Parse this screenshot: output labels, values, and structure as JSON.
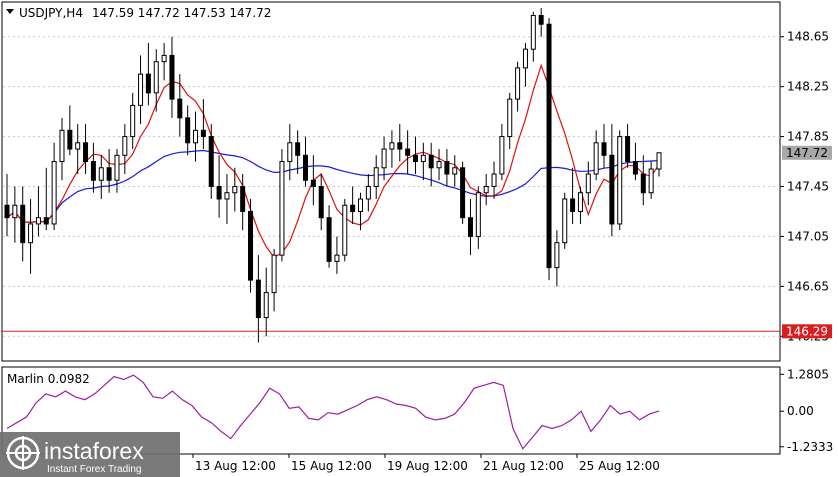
{
  "colors": {
    "bull_fill": "#ffffff",
    "bear_fill": "#000000",
    "candle_stroke": "#000000",
    "ma_fast": "#dd1111",
    "ma_slow": "#1a1adc",
    "support": "#d62020",
    "support_label_bg": "#d62020",
    "price_label_bg": "#a8a8a8",
    "marlin": "#9b1fa0",
    "grid": "#c8c8c8"
  },
  "header": {
    "symbol": "USDJPY,H4",
    "ohlc": "147.59 147.72 147.53 147.72"
  },
  "chart_data": [
    {
      "type": "candlestick",
      "title": "USDJPY,H4",
      "ylim": [
        146.06,
        148.92
      ],
      "y_ticks": [
        "148.65",
        "148.25",
        "147.85",
        "147.45",
        "147.05",
        "146.65",
        "146.25"
      ],
      "x_labels": [
        "13 Aug 12:00",
        "15 Aug 12:00",
        "19 Aug 12:00",
        "21 Aug 12:00",
        "25 Aug 12:00"
      ],
      "grid": true,
      "last_price": "147.72",
      "support_level": "146.29",
      "candles": [
        [
          147.3,
          147.55,
          147.05,
          147.2
        ],
        [
          147.2,
          147.45,
          147.0,
          147.3
        ],
        [
          147.3,
          147.45,
          146.85,
          147.0
        ],
        [
          147.0,
          147.35,
          146.75,
          147.15
        ],
        [
          147.15,
          147.45,
          147.05,
          147.2
        ],
        [
          147.2,
          147.6,
          147.1,
          147.15
        ],
        [
          147.15,
          147.8,
          147.1,
          147.65
        ],
        [
          147.65,
          148.0,
          147.5,
          147.9
        ],
        [
          147.9,
          148.1,
          147.7,
          147.75
        ],
        [
          147.75,
          147.95,
          147.55,
          147.8
        ],
        [
          147.8,
          147.95,
          147.55,
          147.65
        ],
        [
          147.65,
          147.8,
          147.4,
          147.5
        ],
        [
          147.5,
          147.7,
          147.35,
          147.6
        ],
        [
          147.6,
          147.75,
          147.4,
          147.5
        ],
        [
          147.5,
          147.75,
          147.4,
          147.7
        ],
        [
          147.7,
          147.95,
          147.55,
          147.85
        ],
        [
          147.85,
          148.2,
          147.75,
          148.1
        ],
        [
          148.1,
          148.5,
          147.95,
          148.35
        ],
        [
          148.35,
          148.6,
          148.1,
          148.2
        ],
        [
          148.2,
          148.55,
          148.05,
          148.45
        ],
        [
          148.45,
          148.6,
          148.3,
          148.5
        ],
        [
          148.5,
          148.65,
          148.0,
          148.15
        ],
        [
          148.15,
          148.35,
          147.85,
          148.0
        ],
        [
          148.0,
          148.1,
          147.7,
          147.8
        ],
        [
          147.8,
          148.05,
          147.65,
          147.9
        ],
        [
          147.9,
          148.15,
          147.75,
          147.85
        ],
        [
          147.85,
          147.95,
          147.35,
          147.45
        ],
        [
          147.45,
          147.7,
          147.2,
          147.35
        ],
        [
          147.35,
          147.55,
          147.15,
          147.4
        ],
        [
          147.4,
          147.6,
          147.25,
          147.45
        ],
        [
          147.45,
          147.55,
          147.1,
          147.25
        ],
        [
          147.25,
          147.35,
          146.6,
          146.7
        ],
        [
          146.7,
          146.9,
          146.2,
          146.4
        ],
        [
          146.4,
          146.8,
          146.25,
          146.6
        ],
        [
          146.6,
          146.95,
          146.45,
          146.9
        ],
        [
          146.9,
          147.75,
          146.85,
          147.65
        ],
        [
          147.65,
          147.95,
          147.5,
          147.8
        ],
        [
          147.8,
          147.9,
          147.55,
          147.7
        ],
        [
          147.7,
          147.85,
          147.45,
          147.5
        ],
        [
          147.5,
          147.7,
          147.3,
          147.45
        ],
        [
          147.45,
          147.55,
          147.1,
          147.2
        ],
        [
          147.2,
          147.3,
          146.8,
          146.85
        ],
        [
          146.85,
          147.05,
          146.75,
          146.9
        ],
        [
          146.9,
          147.35,
          146.85,
          147.3
        ],
        [
          147.3,
          147.45,
          147.15,
          147.25
        ],
        [
          147.25,
          147.4,
          147.1,
          147.35
        ],
        [
          147.35,
          147.55,
          147.25,
          147.45
        ],
        [
          147.45,
          147.7,
          147.35,
          147.6
        ],
        [
          147.6,
          147.85,
          147.5,
          147.75
        ],
        [
          147.75,
          147.9,
          147.6,
          147.8
        ],
        [
          147.8,
          147.95,
          147.65,
          147.75
        ],
        [
          147.75,
          147.9,
          147.55,
          147.7
        ],
        [
          147.7,
          147.85,
          147.55,
          147.65
        ],
        [
          147.65,
          147.8,
          147.5,
          147.7
        ],
        [
          147.7,
          147.8,
          147.45,
          147.6
        ],
        [
          147.6,
          147.75,
          147.5,
          147.65
        ],
        [
          147.65,
          147.75,
          147.45,
          147.55
        ],
        [
          147.55,
          147.7,
          147.45,
          147.6
        ],
        [
          147.6,
          147.65,
          147.15,
          147.2
        ],
        [
          147.2,
          147.35,
          146.9,
          147.05
        ],
        [
          147.05,
          147.45,
          146.95,
          147.4
        ],
        [
          147.4,
          147.55,
          147.3,
          147.45
        ],
        [
          147.45,
          147.65,
          147.35,
          147.55
        ],
        [
          147.55,
          147.95,
          147.5,
          147.85
        ],
        [
          147.85,
          148.2,
          147.75,
          148.15
        ],
        [
          148.15,
          148.45,
          148.05,
          148.4
        ],
        [
          148.4,
          148.6,
          148.25,
          148.55
        ],
        [
          148.55,
          148.85,
          148.45,
          148.82
        ],
        [
          148.82,
          148.88,
          148.65,
          148.75
        ],
        [
          148.75,
          148.8,
          146.7,
          146.8
        ],
        [
          146.8,
          147.1,
          146.65,
          147.0
        ],
        [
          147.0,
          147.4,
          146.95,
          147.35
        ],
        [
          147.35,
          147.6,
          147.15,
          147.25
        ],
        [
          147.25,
          147.45,
          147.15,
          147.4
        ],
        [
          147.4,
          147.65,
          147.3,
          147.55
        ],
        [
          147.55,
          147.9,
          147.5,
          147.8
        ],
        [
          147.8,
          147.95,
          147.6,
          147.7
        ],
        [
          147.7,
          147.95,
          147.05,
          147.15
        ],
        [
          147.15,
          147.9,
          147.1,
          147.85
        ],
        [
          147.85,
          147.95,
          147.6,
          147.65
        ],
        [
          147.65,
          147.8,
          147.5,
          147.55
        ],
        [
          147.55,
          147.7,
          147.3,
          147.4
        ],
        [
          147.4,
          147.65,
          147.35,
          147.59
        ],
        [
          147.59,
          147.72,
          147.53,
          147.72
        ]
      ]
    },
    {
      "type": "line",
      "title": "Marlin 0.0982",
      "ylim": [
        -1.45,
        1.5
      ],
      "y_ticks": [
        "1.2805",
        "0.00",
        "-1.2333"
      ],
      "series": [
        {
          "values": [
            -0.6,
            -0.4,
            -0.2,
            0.3,
            0.6,
            0.5,
            0.7,
            0.5,
            0.4,
            0.6,
            0.9,
            1.2,
            1.1,
            1.25,
            1.0,
            0.5,
            0.45,
            0.7,
            0.4,
            0.2,
            -0.2,
            -0.4,
            -0.7,
            -0.95,
            -0.5,
            -0.1,
            0.3,
            0.8,
            0.6,
            0.1,
            0.15,
            -0.25,
            -0.3,
            -0.05,
            -0.1,
            0.05,
            0.2,
            0.4,
            0.5,
            0.4,
            0.25,
            0.2,
            0.1,
            -0.2,
            -0.3,
            -0.25,
            -0.1,
            0.3,
            0.8,
            0.9,
            1.0,
            0.9,
            -0.6,
            -1.3,
            -0.9,
            -0.5,
            -0.6,
            -0.5,
            -0.3,
            0.0,
            -0.7,
            -0.3,
            0.2,
            -0.1,
            0.0,
            -0.3,
            -0.1,
            0.0098
          ]
        }
      ]
    }
  ],
  "branding": {
    "name": "instaforex",
    "tagline": "Instant Forex Trading"
  }
}
